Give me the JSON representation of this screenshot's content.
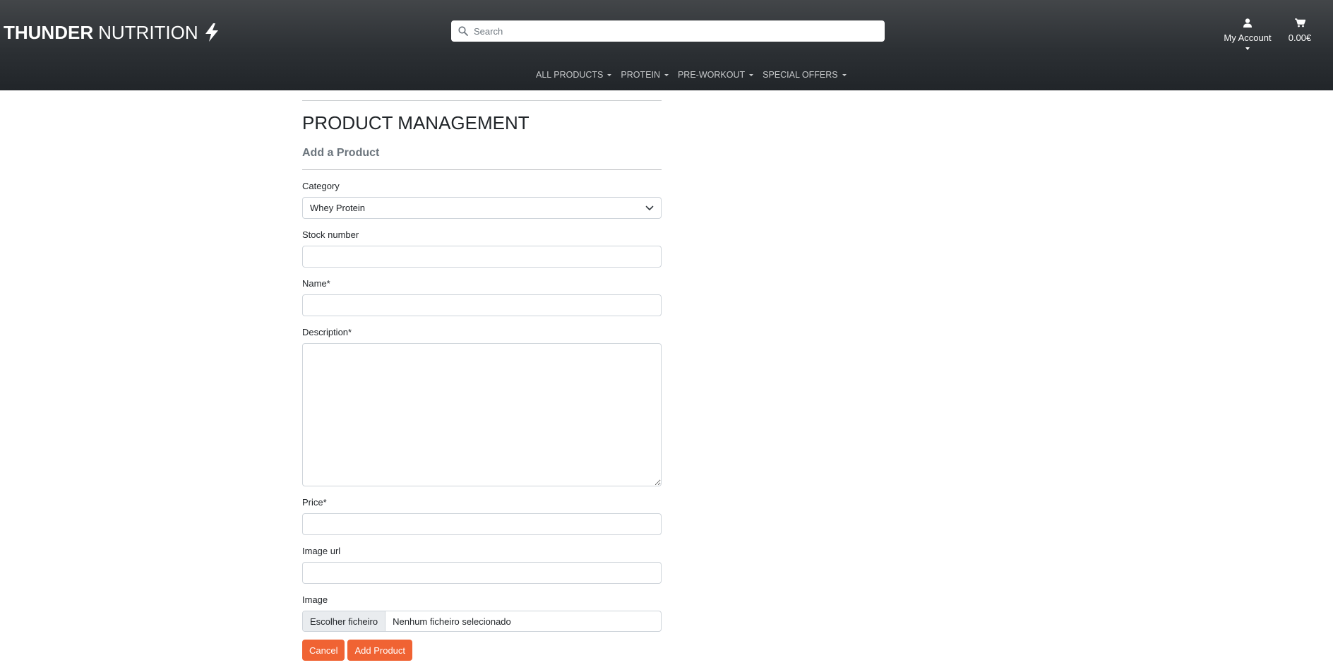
{
  "header": {
    "logo_bold": "THUNDER",
    "logo_light": "NUTRITION",
    "logo_icon": "lightning-bolt-icon",
    "search_placeholder": "Search",
    "account_label": "My Account",
    "cart_total": "0.00€"
  },
  "nav": {
    "items": [
      {
        "label": "ALL PRODUCTS"
      },
      {
        "label": "PROTEIN"
      },
      {
        "label": "PRE-WORKOUT"
      },
      {
        "label": "SPECIAL OFFERS"
      }
    ]
  },
  "main": {
    "title": "PRODUCT MANAGEMENT",
    "subtitle": "Add a Product",
    "form": {
      "category_label": "Category",
      "category_value": "Whey Protein",
      "stock_label": "Stock number",
      "name_label": "Name*",
      "description_label": "Description*",
      "price_label": "Price*",
      "image_url_label": "Image url",
      "image_label": "Image",
      "file_button": "Escolher ficheiro",
      "file_status": "Nenhum ficheiro selecionado"
    },
    "actions": {
      "cancel": "Cancel",
      "add": "Add Product"
    }
  },
  "colors": {
    "header_bg": "#212529",
    "accent": "#f06333"
  }
}
